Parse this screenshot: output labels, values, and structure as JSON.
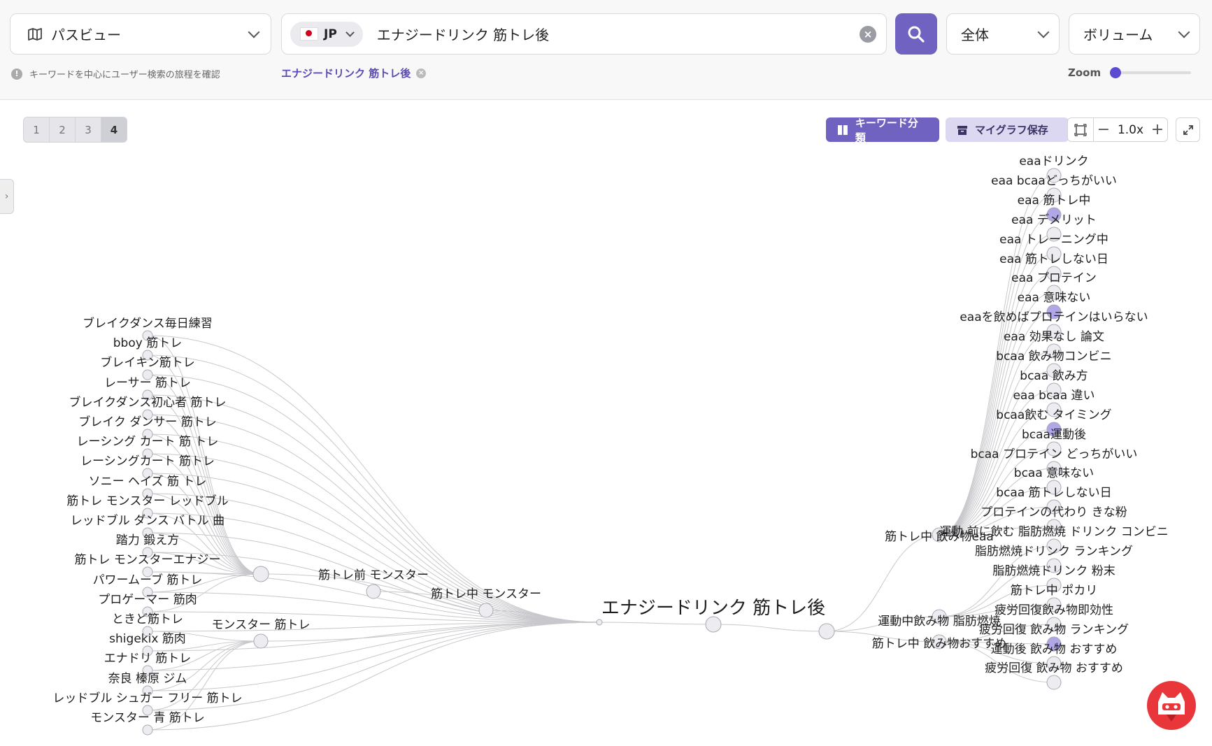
{
  "header": {
    "view_selector": "パスビュー",
    "country_code": "JP",
    "query": "エナジードリンク 筋トレ後",
    "scope": "全体",
    "metric": "ボリューム",
    "hint": "キーワードを中心にユーザー検索の旅程を確認",
    "active_tag": "エナジードリンク 筋トレ後",
    "zoom_label": "Zoom",
    "zoom_slider_fraction": 0.02
  },
  "toolbar": {
    "levels": [
      "1",
      "2",
      "3",
      "4"
    ],
    "active_level": "4",
    "classify_label": "キーワード分類",
    "save_label": "マイグラフ保存",
    "zoom_value": "1.0x"
  },
  "colors": {
    "accent": "#6f62c0",
    "accent_light": "#dcd8f2",
    "node_fill": "#ececf1",
    "node_highlight": "#b0a8e6",
    "edge": "#c8c8cc"
  },
  "graph": {
    "center": "エナジードリンク 筋トレ後",
    "left_hubs": [
      "筋トレ前 モンスター",
      "筋トレ中 モンスター",
      "モンスター 筋トレ"
    ],
    "left_leaves": [
      "ブレイクダンス毎日練習",
      "bboy 筋トレ",
      "ブレイキン筋トレ",
      "レーサー 筋トレ",
      "ブレイクダンス初心者 筋トレ",
      "ブレイク ダンサー 筋トレ",
      "レーシング カート 筋 トレ",
      "レーシングカート 筋トレ",
      "ソニー ヘイズ 筋 トレ",
      "筋トレ モンスター レッドブル",
      "レッドブル ダンス バトル 曲",
      "踏力 鍛え方",
      "筋トレ モンスターエナジー",
      "パワームーブ 筋トレ",
      "プロゲーマー 筋肉",
      "ときど筋トレ",
      "shigekix 筋肉",
      "エナドリ 筋トレ",
      "奈良 榛原 ジム",
      "レッドブル シュガー フリー 筋トレ",
      "モンスター 青 筋トレ"
    ],
    "right_hubs": [
      "筋トレ中 飲み物eaa",
      "運動中飲み物 脂肪燃焼",
      "筋トレ中 飲み物おすすめ"
    ],
    "right_leaves": [
      "eaaドリンク",
      "eaa bcaaどっちがいい",
      "eaa 筋トレ中",
      "eaa デメリット",
      "eaa トレーニング中",
      "eaa 筋トレしない日",
      "eaa プロテイン",
      "eaa 意味ない",
      "eaaを飲めばプロテインはいらない",
      "eaa 効果なし 論文",
      "bcaa 飲み物コンビニ",
      "bcaa 飲み方",
      "eaa bcaa 違い",
      "bcaa飲む タイミング",
      "bcaa運動後",
      "bcaa プロテイン どっちがいい",
      "bcaa 意味ない",
      "bcaa 筋トレしない日",
      "プロテインの代わり きな粉",
      "運動 前に飲む 脂肪燃焼 ドリンク コンビニ",
      "脂肪燃焼ドリンク ランキング",
      "脂肪燃焼ドリンク 粉末",
      "筋トレ中 ポカリ",
      "疲労回復飲み物即効性",
      "疲労回復 飲み物 ランキング",
      "運動後 飲み物 おすすめ",
      "疲労回復 飲み物 おすすめ"
    ]
  }
}
